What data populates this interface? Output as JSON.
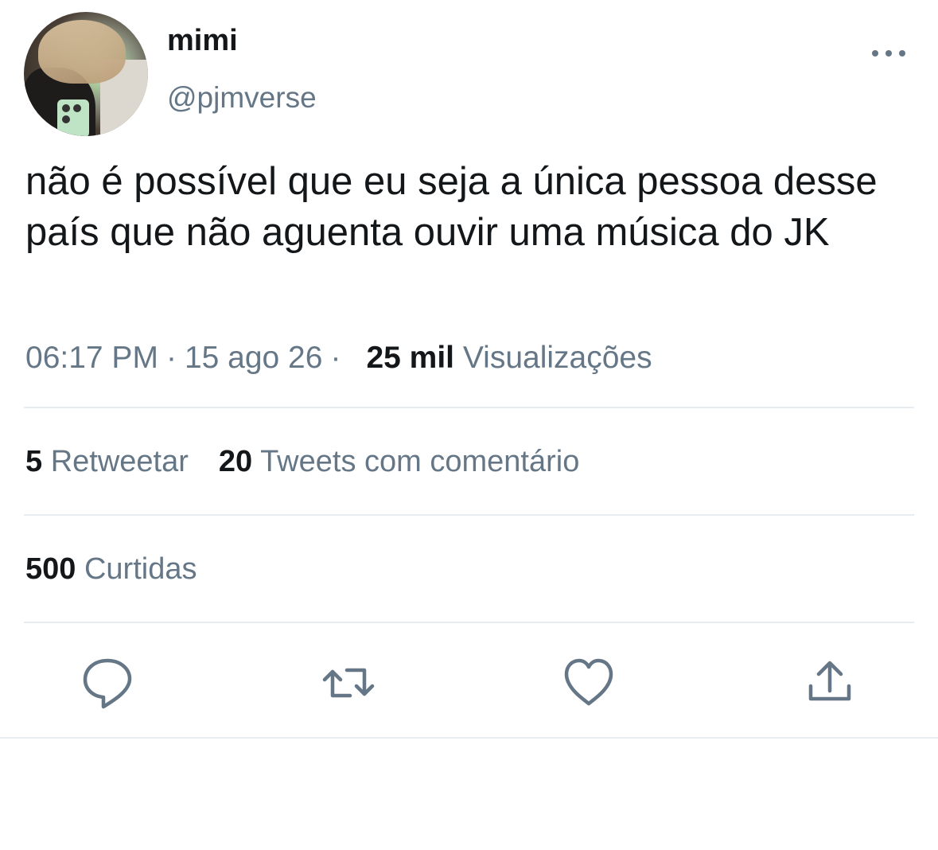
{
  "author": {
    "name": "mimi",
    "handle": "@pjmverse"
  },
  "tweet": {
    "text": "não é possível que eu seja a única pessoa desse país que não aguenta ouvir uma música do JK"
  },
  "meta": {
    "time": "06:17 PM",
    "dot": "·",
    "date": "15 ago 26",
    "views_count": "25 mil",
    "views_label": "Visualizações"
  },
  "stats": {
    "retweets_count": "5",
    "retweets_label": "Retweetar",
    "quotes_count": "20",
    "quotes_label": "Tweets com comentário",
    "likes_count": "500",
    "likes_label": "Curtidas"
  },
  "actions": {
    "icons": [
      "reply-icon",
      "retweet-icon",
      "like-icon",
      "share-icon"
    ],
    "icon_color": "#657786"
  },
  "colors": {
    "text": "#14171a",
    "secondary": "#657786",
    "divider": "#e6ecf0"
  }
}
